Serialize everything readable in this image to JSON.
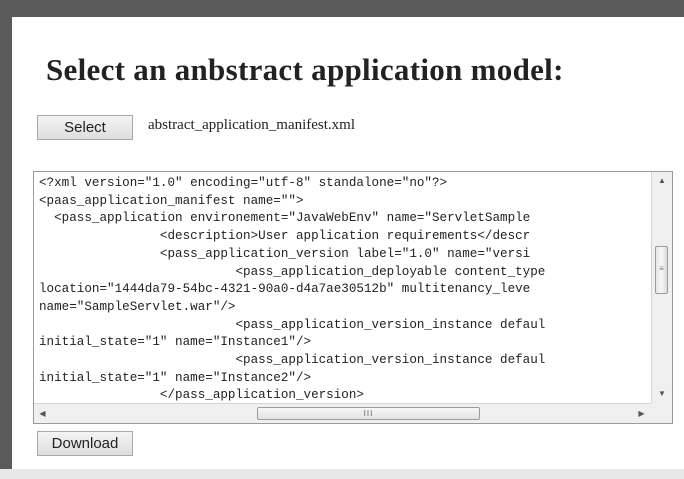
{
  "page": {
    "title": "Select an anbstract application model:"
  },
  "select": {
    "button_label": "Select",
    "file_name": "abstract_application_manifest.xml"
  },
  "manifest": {
    "lines": [
      "<?xml version=\"1.0\" encoding=\"utf-8\" standalone=\"no\"?>",
      "<paas_application_manifest name=\"\">",
      "  <pass_application environement=\"JavaWebEnv\" name=\"ServletSample",
      "                <description>User application requirements</descr",
      "                <pass_application_version label=\"1.0\" name=\"versi",
      "                          <pass_application_deployable content_type",
      "location=\"1444da79-54bc-4321-90a0-d4a7ae30512b\" multitenancy_leve",
      "name=\"SampleServlet.war\"/>",
      "                          <pass_application_version_instance defaul",
      "initial_state=\"1\" name=\"Instance1\"/>",
      "                          <pass_application_version_instance defaul",
      "initial_state=\"1\" name=\"Instance2\"/>",
      "                </pass_application_version>"
    ]
  },
  "download": {
    "button_label": "Download"
  },
  "scrollbars": {
    "vertical_grip": "≡",
    "horizontal_grip": "III",
    "up_arrow": "▲",
    "down_arrow": "▼",
    "left_arrow": "◀",
    "right_arrow": "▶"
  }
}
